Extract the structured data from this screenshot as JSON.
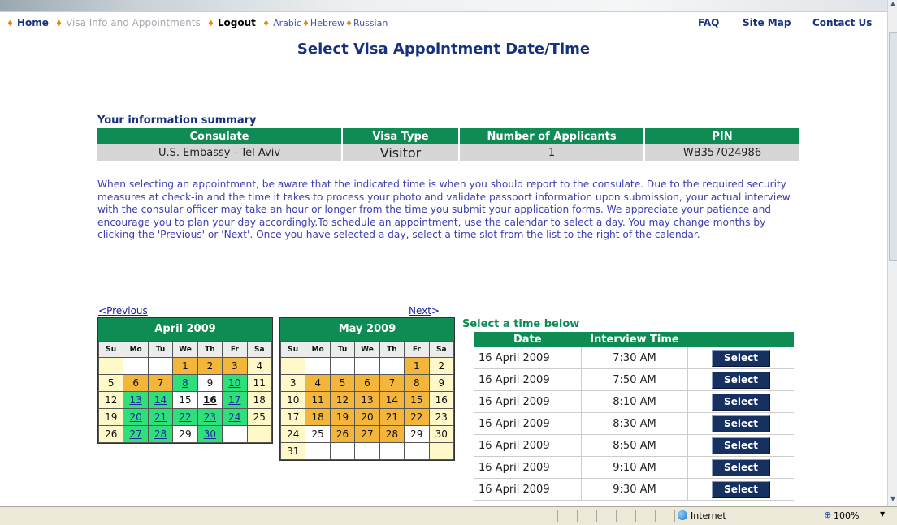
{
  "nav": {
    "home": "Home",
    "visa_info": "Visa Info and Appointments",
    "logout": "Logout",
    "languages": [
      "Arabic",
      "Hebrew",
      "Russian"
    ],
    "faq": "FAQ",
    "site_map": "Site Map",
    "contact": "Contact Us"
  },
  "page_title": "Select Visa Appointment Date/Time",
  "summary": {
    "label": "Your information summary",
    "headers": [
      "Consulate",
      "Visa Type",
      "Number of Applicants",
      "PIN"
    ],
    "values": [
      "U.S. Embassy - Tel Aviv",
      "Visitor",
      "1",
      "WB357024986"
    ]
  },
  "instructions": "When selecting an appointment, be aware that the indicated time is when you should report to the consulate. Due to the required security measures at check-in and the time it takes to process your photo and validate passport information upon submission, your actual interview with the consular officer may take an hour or longer from the time you submit your application forms. We appreciate your patience and encourage you to plan your day accordingly.To schedule an appointment, use the calendar to select a day. You may change months by clicking the 'Previous' or 'Next'. Once you have selected a day, select a time slot from the list to the right of the calendar.",
  "calendar_nav": {
    "previous": "Previous",
    "next": "Next"
  },
  "weekdays": [
    "Su",
    "Mo",
    "Tu",
    "We",
    "Th",
    "Fr",
    "Sa"
  ],
  "time_section": {
    "header": "Select a time below",
    "columns": [
      "Date",
      "Interview Time",
      ""
    ],
    "select_label": "Select",
    "rows": [
      {
        "date": "16 April 2009",
        "time": "7:30 AM"
      },
      {
        "date": "16 April 2009",
        "time": "7:50 AM"
      },
      {
        "date": "16 April 2009",
        "time": "8:10 AM"
      },
      {
        "date": "16 April 2009",
        "time": "8:30 AM"
      },
      {
        "date": "16 April 2009",
        "time": "8:50 AM"
      },
      {
        "date": "16 April 2009",
        "time": "9:10 AM"
      },
      {
        "date": "16 April 2009",
        "time": "9:30 AM"
      }
    ]
  },
  "status_bar": {
    "zone": "Internet",
    "zoom": "100%"
  },
  "colors": {
    "header_green": "#0e8c53",
    "available": "#2fe07a",
    "full": "#f3b53a",
    "weekend": "#fff8c8",
    "title_blue": "#16317f"
  }
}
